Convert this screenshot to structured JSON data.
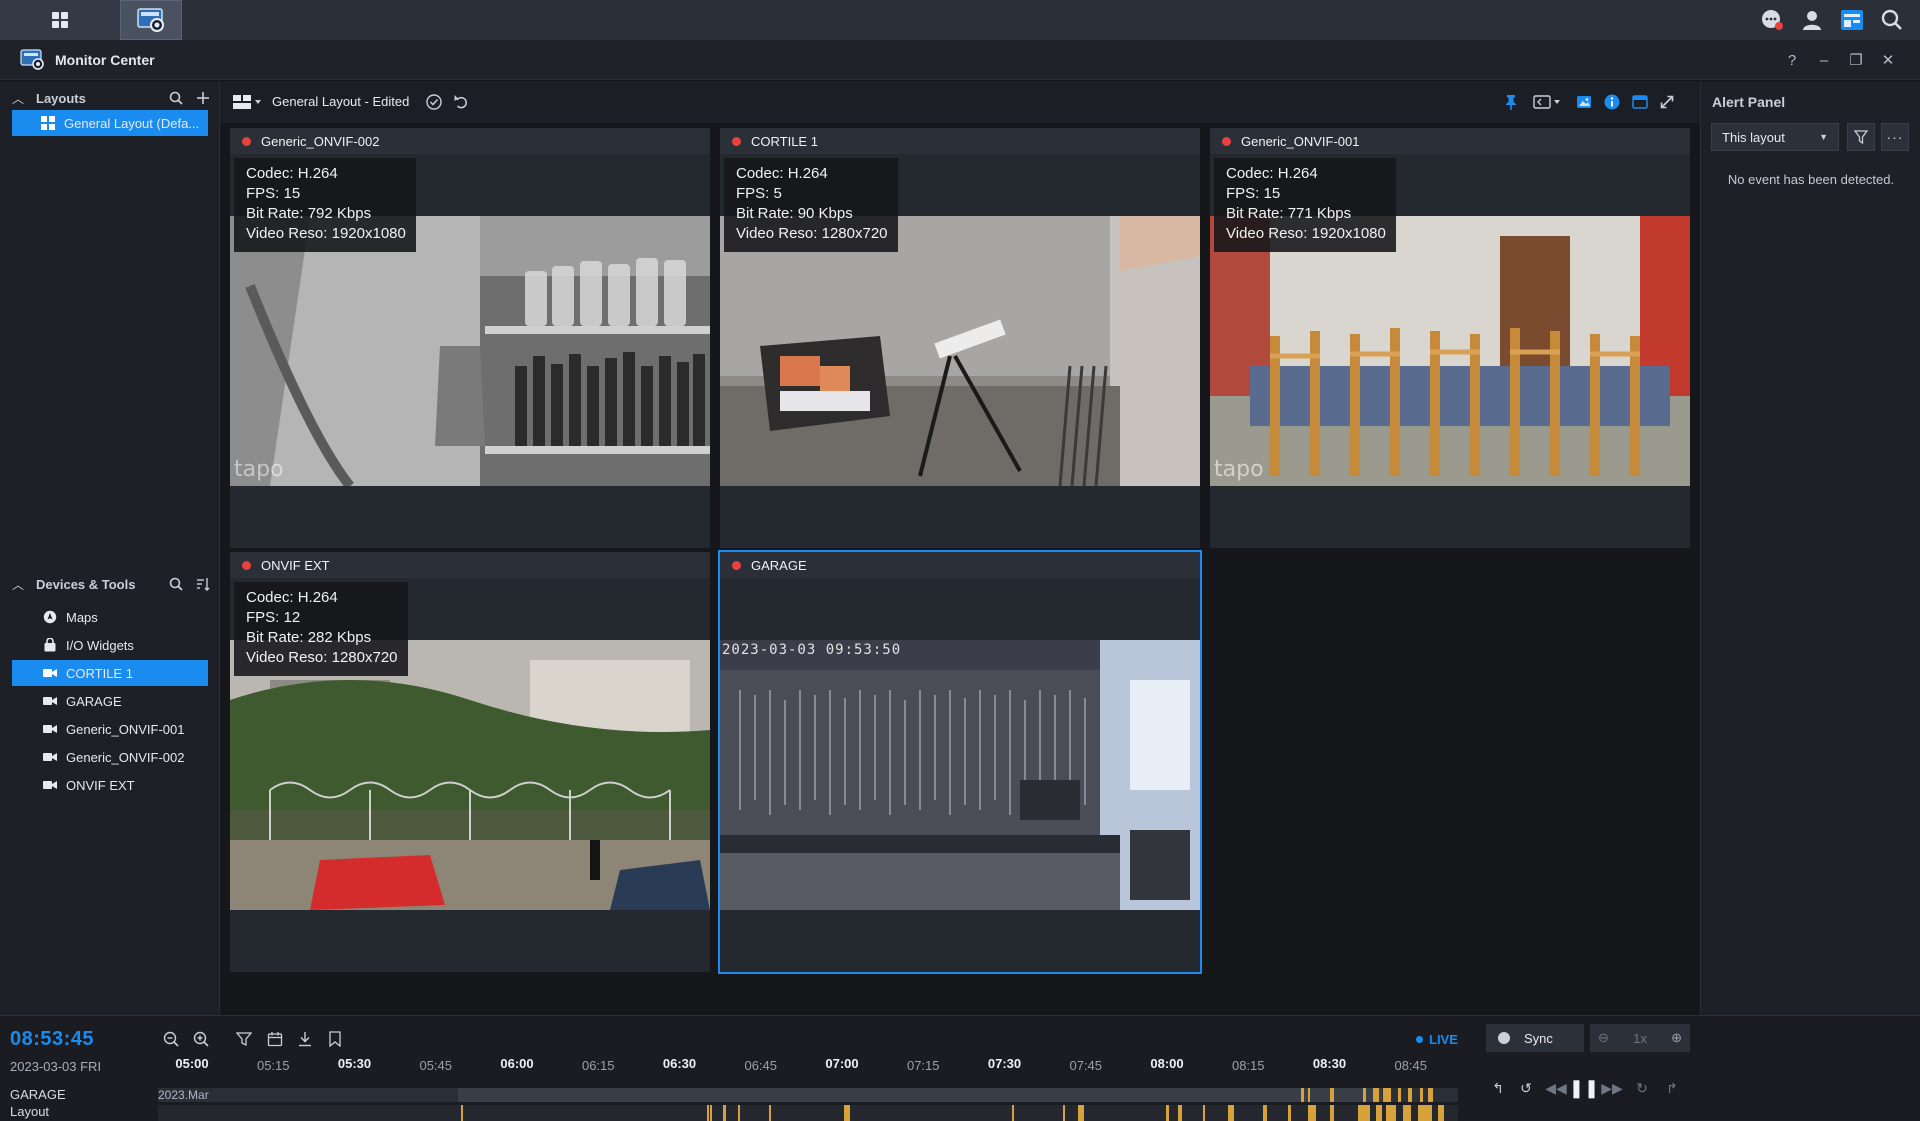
{
  "app": {
    "title": "Monitor Center"
  },
  "taskbar": {
    "apps_icon": "grid-icon",
    "monitor_icon": "monitor-center-icon"
  },
  "tray": [
    "chat-icon",
    "user-icon",
    "widgets-icon",
    "search-icon"
  ],
  "window_controls": {
    "help": "?",
    "minimize": "–",
    "restore": "❐",
    "close": "✕"
  },
  "layouts_panel": {
    "title": "Layouts",
    "selected_layout": "General Layout (Defa..."
  },
  "devices_panel": {
    "title": "Devices & Tools",
    "items": [
      {
        "label": "Maps",
        "icon": "map-icon"
      },
      {
        "label": "I/O Widgets",
        "icon": "io-widget-icon"
      },
      {
        "label": "CORTILE 1",
        "icon": "camera-icon",
        "selected": true
      },
      {
        "label": "GARAGE",
        "icon": "camera-icon"
      },
      {
        "label": "Generic_ONVIF-001",
        "icon": "camera-icon"
      },
      {
        "label": "Generic_ONVIF-002",
        "icon": "camera-icon"
      },
      {
        "label": "ONVIF EXT",
        "icon": "camera-icon"
      }
    ]
  },
  "toolbar": {
    "layout_name": "General Layout - Edited"
  },
  "tiles": [
    {
      "name": "Generic_ONVIF-002",
      "codec": "Codec: H.264",
      "fps": "FPS: 15",
      "bitrate": "Bit Rate: 792 Kbps",
      "reso": "Video Reso: 1920x1080",
      "watermark": "tapo"
    },
    {
      "name": "CORTILE 1",
      "codec": "Codec: H.264",
      "fps": "FPS: 5",
      "bitrate": "Bit Rate: 90 Kbps",
      "reso": "Video Reso: 1280x720"
    },
    {
      "name": "Generic_ONVIF-001",
      "codec": "Codec: H.264",
      "fps": "FPS: 15",
      "bitrate": "Bit Rate: 771 Kbps",
      "reso": "Video Reso: 1920x1080",
      "watermark": "tapo"
    },
    {
      "name": "ONVIF EXT",
      "codec": "Codec: H.264",
      "fps": "FPS: 12",
      "bitrate": "Bit Rate: 282 Kbps",
      "reso": "Video Reso: 1280x720"
    },
    {
      "name": "GARAGE",
      "osd": "2023-03-03  09:53:50"
    }
  ],
  "alert_panel": {
    "title": "Alert Panel",
    "filter": "This layout",
    "empty_message": "No event has been detected."
  },
  "timeline": {
    "clock": "08:53:45",
    "date": "2023-03-03 FRI",
    "live": "LIVE",
    "rows": [
      "GARAGE",
      "Layout"
    ],
    "track_label": "2023.Mar",
    "ticks": [
      {
        "t": "05:00",
        "kind": "major"
      },
      {
        "t": "05:15",
        "kind": "minor"
      },
      {
        "t": "05:30",
        "kind": "major"
      },
      {
        "t": "05:45",
        "kind": "minor"
      },
      {
        "t": "06:00",
        "kind": "major"
      },
      {
        "t": "06:15",
        "kind": "minor"
      },
      {
        "t": "06:30",
        "kind": "major"
      },
      {
        "t": "06:45",
        "kind": "minor"
      },
      {
        "t": "07:00",
        "kind": "major"
      },
      {
        "t": "07:15",
        "kind": "minor"
      },
      {
        "t": "07:30",
        "kind": "major"
      },
      {
        "t": "07:45",
        "kind": "minor"
      },
      {
        "t": "08:00",
        "kind": "major"
      },
      {
        "t": "08:15",
        "kind": "minor"
      },
      {
        "t": "08:30",
        "kind": "major"
      },
      {
        "t": "08:45",
        "kind": "minor"
      }
    ],
    "sync": "Sync",
    "speed": "1x"
  },
  "colors": {
    "accent": "#1a8cf0",
    "recording": "#e8423f",
    "event": "#d7a23b"
  }
}
